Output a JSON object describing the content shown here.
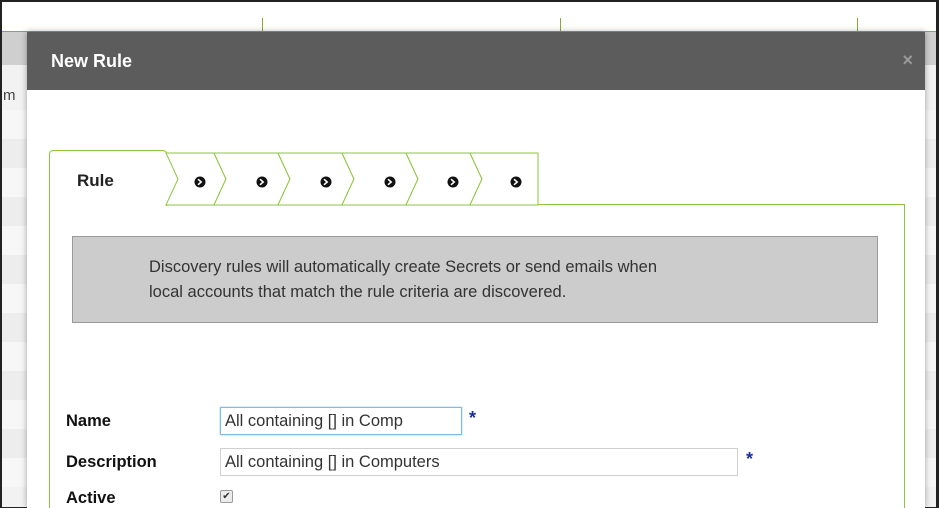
{
  "background": {
    "partial_text": "m"
  },
  "modal": {
    "title": "New Rule",
    "close_label": "×"
  },
  "tabs": {
    "active_label": "Rule",
    "step_count": 6,
    "step_icon": "circle-arrow-right-icon"
  },
  "info": {
    "line1": "Discovery rules will automatically create Secrets or send emails when",
    "line2": "local accounts that match the rule criteria are discovered."
  },
  "form": {
    "name": {
      "label": "Name",
      "value": "All containing [] in Comp",
      "required_mark": "*"
    },
    "description": {
      "label": "Description",
      "value": "All containing [] in Computers",
      "required_mark": "*"
    },
    "active": {
      "label": "Active",
      "checked": true,
      "check_glyph": "✔"
    }
  },
  "colors": {
    "accent_green": "#8cc63f",
    "modal_header": "#5c5c5c",
    "required_blue": "#1a2e9e",
    "info_box": "#cccccc"
  }
}
